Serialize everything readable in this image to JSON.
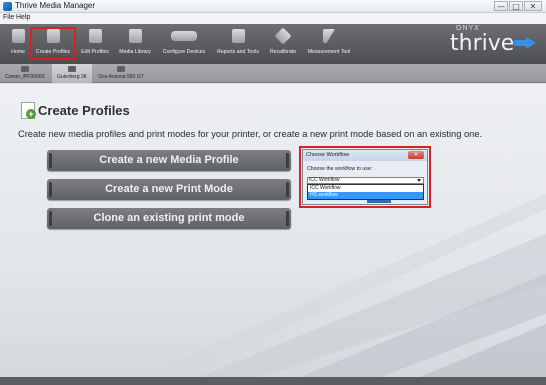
{
  "window": {
    "title": "Thrive Media Manager",
    "controls": {
      "minimize": "—",
      "maximize": "□",
      "close": "✕"
    }
  },
  "menu": {
    "items": [
      "File",
      "Help"
    ]
  },
  "toolbar": {
    "items": [
      {
        "label": "Home",
        "icon": "home-icon"
      },
      {
        "label": "Create Profiles",
        "icon": "create-profiles-icon",
        "selected": true
      },
      {
        "label": "Edit Profiles",
        "icon": "edit-profiles-icon"
      },
      {
        "label": "Media Library",
        "icon": "media-library-icon"
      },
      {
        "label": "Configure Devices",
        "icon": "configure-devices-icon"
      },
      {
        "label": "Reports and Tools",
        "icon": "reports-tools-icon"
      },
      {
        "label": "Recalibrate",
        "icon": "recalibrate-icon"
      },
      {
        "label": "Measurement Tool",
        "icon": "measurement-tool-icon"
      }
    ]
  },
  "logo": {
    "brand": "ONYX",
    "product": "thrive"
  },
  "printers": [
    {
      "label": "Canon_iPF9000S"
    },
    {
      "label": "Guterberg 3K",
      "active": true
    },
    {
      "label": "Oce Arizona 550 GT"
    }
  ],
  "page": {
    "title": "Create Profiles",
    "description": "Create new media profiles and print modes for your printer, or create a new print mode based on an existing one.",
    "buttons": [
      "Create a new Media Profile",
      "Create a new Print Mode",
      "Clone an existing print mode"
    ]
  },
  "dialog": {
    "title": "Choose Workflow",
    "close": "✕",
    "prompt": "Choose the workflow to use:",
    "selected": "ICC Workflow",
    "options": [
      "ICC Workflow",
      "HS workflow"
    ],
    "highlighted_option": "HS workflow"
  },
  "colors": {
    "highlight": "#d62125",
    "toolbar": "#5a5c5f",
    "button": "#6e7073",
    "selection": "#3399ff"
  }
}
